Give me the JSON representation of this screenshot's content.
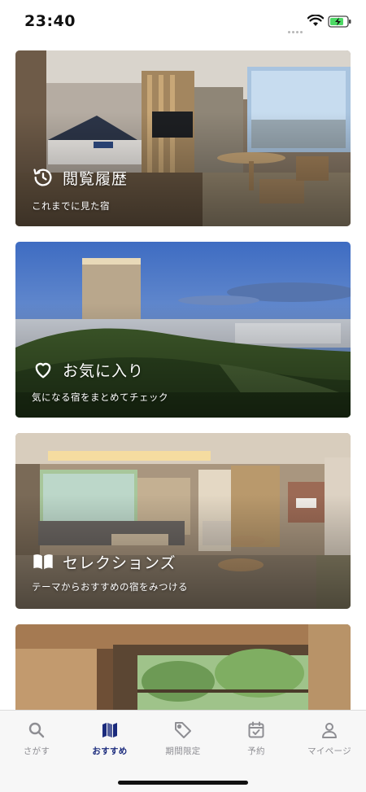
{
  "status_bar": {
    "time": "23:40"
  },
  "cards": [
    {
      "title": "閲覧履歴",
      "subtitle": "これまでに見た宿",
      "icon": "history-icon"
    },
    {
      "title": "お気に入り",
      "subtitle": "気になる宿をまとめてチェック",
      "icon": "heart-icon"
    },
    {
      "title": "セレクションズ",
      "subtitle": "テーマからおすすめの宿をみつける",
      "icon": "book-icon"
    },
    {
      "title": "",
      "subtitle": "",
      "icon": ""
    }
  ],
  "tabbar": {
    "active_color": "#1a2a7c",
    "inactive_color": "#8e8e93",
    "items": [
      {
        "label": "さがす",
        "icon": "search-icon",
        "active": false
      },
      {
        "label": "おすすめ",
        "icon": "map-icon",
        "active": true
      },
      {
        "label": "期間限定",
        "icon": "tag-icon",
        "active": false
      },
      {
        "label": "予約",
        "icon": "calendar-check-icon",
        "active": false
      },
      {
        "label": "マイページ",
        "icon": "person-icon",
        "active": false
      }
    ]
  }
}
